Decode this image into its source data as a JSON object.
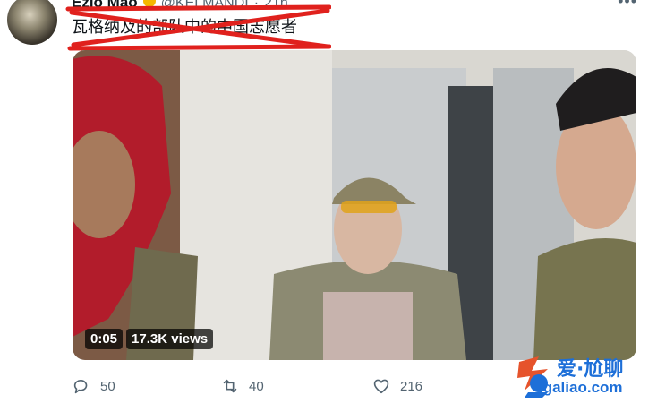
{
  "tweet": {
    "display_name": "Ezio Mao",
    "verified_icon": "verified-badge-icon",
    "handle": "@KELMANDI",
    "separator": "·",
    "timestamp": "21h",
    "text": "瓦格纳及的部队中的中国志愿者",
    "more_icon": "more-dots-icon"
  },
  "video": {
    "duration": "0:05",
    "views": "17.3K views"
  },
  "actions": {
    "reply_count": "50",
    "retweet_count": "40",
    "like_count": "216"
  },
  "watermark": {
    "title": "爱·尬聊",
    "url": "igaliao.com"
  },
  "colors": {
    "strike": "#e0211d",
    "muted": "#536471",
    "watermark": "#1d6fd8"
  }
}
